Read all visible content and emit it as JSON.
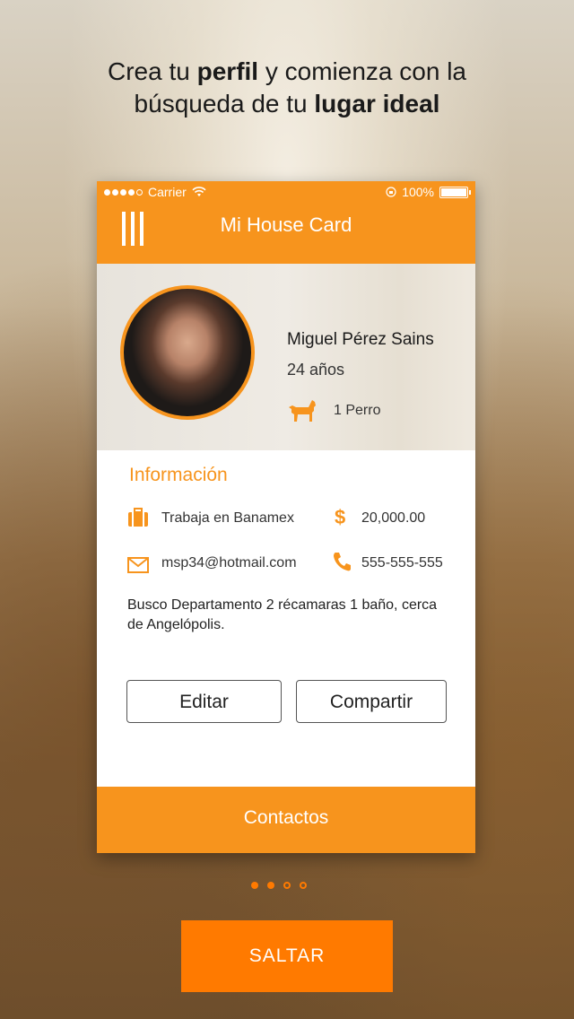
{
  "onboarding": {
    "headline_part1": "Crea tu ",
    "headline_bold1": "perfil",
    "headline_part2": " y comienza con la",
    "headline_part3": "búsqueda de tu ",
    "headline_bold2": "lugar ideal",
    "skip_label": "SALTAR",
    "pager": {
      "pages": 4,
      "active": [
        0,
        1
      ]
    }
  },
  "status_bar": {
    "carrier": "Carrier",
    "battery": "100%"
  },
  "app_header": {
    "title": "Mi House Card",
    "menu_icon": "menu-bars-icon"
  },
  "profile": {
    "name": "Miguel Pérez Sains",
    "age": "24 años",
    "pet_icon": "dog-icon",
    "pet": "1 Perro"
  },
  "info": {
    "section_title": "Información",
    "work": "Trabaja en Banamex",
    "work_icon": "briefcase-icon",
    "salary": "20,000.00",
    "salary_icon": "dollar-icon",
    "email": "msp34@hotmail.com",
    "email_icon": "mail-icon",
    "phone": "555-555-555",
    "phone_icon": "phone-icon",
    "description": "Busco Departamento 2 récamaras 1 baño, cerca de Angelópolis."
  },
  "actions": {
    "edit_label": "Editar",
    "share_label": "Compartir"
  },
  "footer": {
    "contacts_label": "Contactos"
  },
  "colors": {
    "accent": "#f7941d",
    "skip": "#ff7a00"
  }
}
